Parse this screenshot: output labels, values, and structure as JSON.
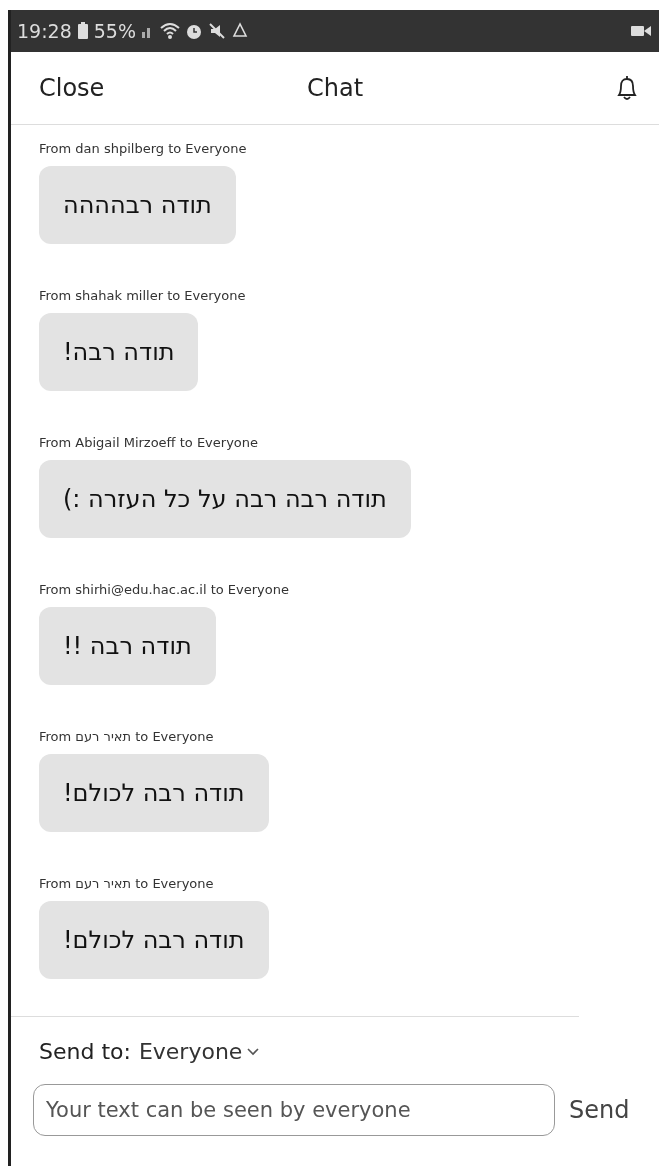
{
  "status_bar": {
    "time": "19:28",
    "battery": "55%"
  },
  "header": {
    "close": "Close",
    "title": "Chat"
  },
  "messages": [
    {
      "sender": "From dan shpilberg to Everyone",
      "text": "תודה רבהההה"
    },
    {
      "sender": "From shahak miller to Everyone",
      "text": "תודה רבה!"
    },
    {
      "sender": "From Abigail Mirzoeff to Everyone",
      "text": "תודה רבה רבה על כל העזרה :)"
    },
    {
      "sender": "From shirhi@edu.hac.ac.il to Everyone",
      "text": "תודה רבה !!"
    },
    {
      "sender": "From תאיר רעם to Everyone",
      "text": "תודה רבה לכולם!"
    },
    {
      "sender": "From תאיר רעם to Everyone",
      "text": "תודה רבה לכולם!"
    }
  ],
  "composer": {
    "send_to_label": "Send to:",
    "recipient": "Everyone",
    "placeholder": "Your text can be seen by everyone",
    "send": "Send"
  }
}
